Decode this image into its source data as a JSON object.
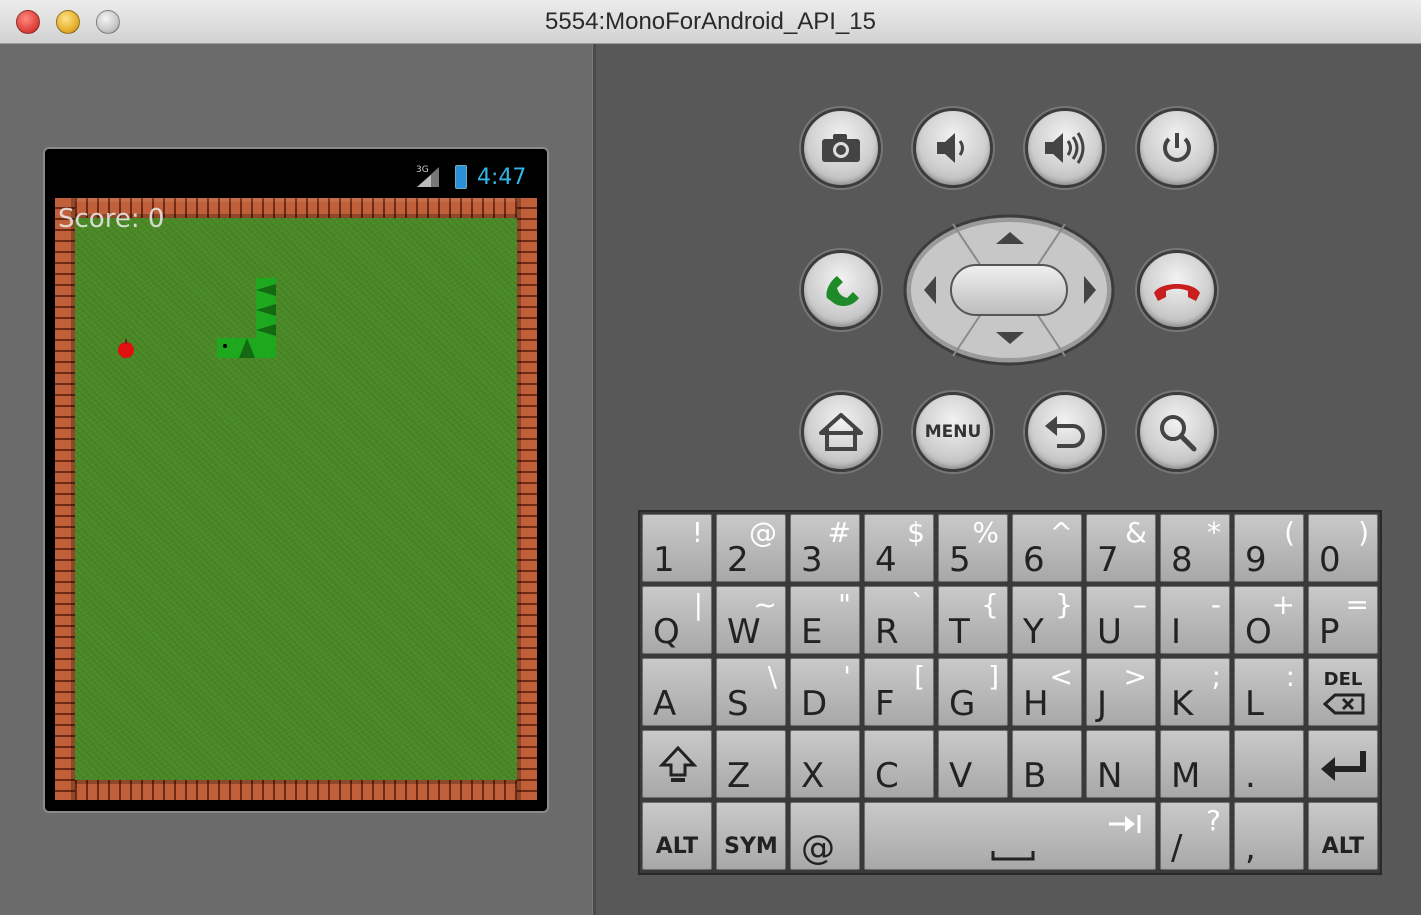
{
  "window": {
    "title": "5554:MonoForAndroid_API_15"
  },
  "device": {
    "status": {
      "network": "3G",
      "time": "4:47"
    },
    "game": {
      "score_text": "Score: 0"
    }
  },
  "hardware_buttons": {
    "menu_label": "MENU"
  },
  "keyboard": {
    "rows": [
      [
        {
          "main": "1",
          "alt": "!"
        },
        {
          "main": "2",
          "alt": "@"
        },
        {
          "main": "3",
          "alt": "#"
        },
        {
          "main": "4",
          "alt": "$"
        },
        {
          "main": "5",
          "alt": "%"
        },
        {
          "main": "6",
          "alt": "^"
        },
        {
          "main": "7",
          "alt": "&"
        },
        {
          "main": "8",
          "alt": "*"
        },
        {
          "main": "9",
          "alt": "("
        },
        {
          "main": "0",
          "alt": ")"
        }
      ],
      [
        {
          "main": "Q",
          "alt": "|"
        },
        {
          "main": "W",
          "alt": "~"
        },
        {
          "main": "E",
          "alt": "\""
        },
        {
          "main": "R",
          "alt": "`"
        },
        {
          "main": "T",
          "alt": "{"
        },
        {
          "main": "Y",
          "alt": "}"
        },
        {
          "main": "U",
          "alt": "–"
        },
        {
          "main": "I",
          "alt": "-"
        },
        {
          "main": "O",
          "alt": "+"
        },
        {
          "main": "P",
          "alt": "="
        }
      ],
      [
        {
          "main": "A",
          "alt": ""
        },
        {
          "main": "S",
          "alt": "\\"
        },
        {
          "main": "D",
          "alt": "'"
        },
        {
          "main": "F",
          "alt": "["
        },
        {
          "main": "G",
          "alt": "]"
        },
        {
          "main": "H",
          "alt": "<"
        },
        {
          "main": "J",
          "alt": ">"
        },
        {
          "main": "K",
          "alt": ";"
        },
        {
          "main": "L",
          "alt": ":"
        }
      ],
      [
        {
          "main": "Z",
          "alt": ""
        },
        {
          "main": "X",
          "alt": ""
        },
        {
          "main": "C",
          "alt": ""
        },
        {
          "main": "V",
          "alt": ""
        },
        {
          "main": "B",
          "alt": ""
        },
        {
          "main": "N",
          "alt": ""
        },
        {
          "main": "M",
          "alt": ""
        },
        {
          "main": ".",
          "alt": ""
        }
      ]
    ],
    "del_label": "DEL",
    "alt_label": "ALT",
    "sym_label": "SYM",
    "at_label": "@",
    "slash_main": "/",
    "slash_alt": "?",
    "comma_main": ","
  },
  "colors": {
    "accent_clock": "#33b5e5",
    "call_green": "#1e8a2a",
    "end_red": "#c81e1e",
    "snake": "#1ea81e"
  }
}
